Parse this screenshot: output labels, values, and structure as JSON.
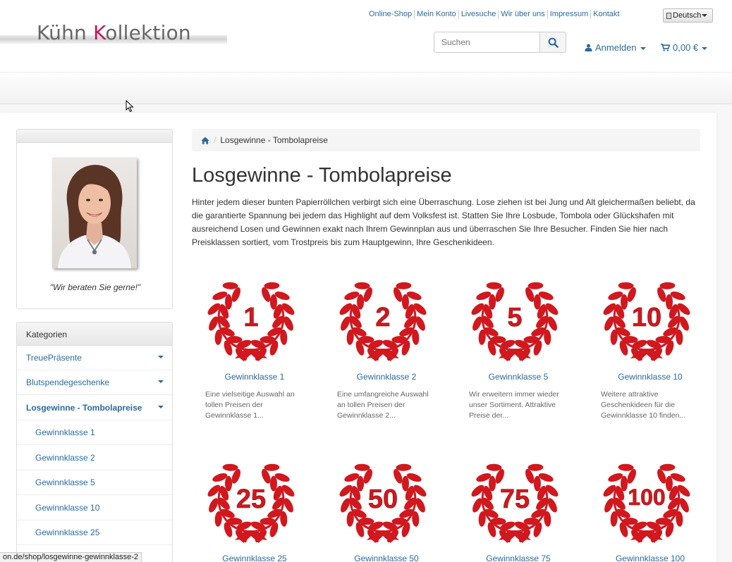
{
  "header": {
    "logo": {
      "part1": "Kühn ",
      "k": "K",
      "part2": "ollektion"
    },
    "top_links": [
      "Online-Shop",
      "Mein Konto",
      "Livesuche",
      "Wir über uns",
      "Impressum",
      "Kontakt"
    ],
    "language": "Deutsch",
    "search": {
      "placeholder": "Suchen"
    },
    "login_label": "Anmelden",
    "cart_label": "0,00 €"
  },
  "sidebar": {
    "quote": "\"Wir beraten Sie gerne!\"",
    "categories_title": "Kategorien",
    "categories": [
      {
        "label": "TreuePräsente",
        "dropdown": true
      },
      {
        "label": "Blutspendegeschenke",
        "dropdown": true
      },
      {
        "label": "Losgewinne - Tombolapreise",
        "dropdown": true,
        "active": true
      },
      {
        "label": "Gewinnklasse 1",
        "sub": true
      },
      {
        "label": "Gewinnklasse 2",
        "sub": true
      },
      {
        "label": "Gewinnklasse 5",
        "sub": true
      },
      {
        "label": "Gewinnklasse 10",
        "sub": true
      },
      {
        "label": "Gewinnklasse 25",
        "sub": true
      }
    ]
  },
  "main": {
    "breadcrumb_current": "Losgewinne - Tombolapreise",
    "title": "Losgewinne - Tombolapreise",
    "intro": "Hinter jedem dieser bunten Papierröllchen verbirgt sich eine Überraschung. Lose ziehen ist bei Jung und Alt gleichermaßen beliebt, da die garantierte Spannung bei jedem das Highlight auf dem Volksfest ist. Statten Sie Ihre Losbude, Tombola oder Glückshafen mit ausreichend Losen und Gewinnen exakt nach Ihrem Gewinnplan aus und überraschen Sie Ihre Besucher. Finden Sie hier nach Preisklassen sortiert, vom Trostpreis bis zum Hauptgewinn, Ihre Geschenkideen.",
    "products": [
      {
        "number": "1",
        "name": "Gewinnklasse 1",
        "desc": "Eine vielseitige Auswahl an tollen Preisen der Gewinnklasse 1..."
      },
      {
        "number": "2",
        "name": "Gewinnklasse 2",
        "desc": "Eine umfangreiche Auswahl an tollen Preisen der Gewinnklasse 2..."
      },
      {
        "number": "5",
        "name": "Gewinnklasse 5",
        "desc": "Wir erweitern immer wieder unser Sortiment. Attraktive Preise der..."
      },
      {
        "number": "10",
        "name": "Gewinnklasse 10",
        "desc": "Weitere attraktive Geschenkideen für die Gewinnklasse 10 finden..."
      },
      {
        "number": "25",
        "name": "Gewinnklasse 25",
        "desc": ""
      },
      {
        "number": "50",
        "name": "Gewinnklasse 50",
        "desc": ""
      },
      {
        "number": "75",
        "name": "Gewinnklasse 75",
        "desc": ""
      },
      {
        "number": "100",
        "name": "Gewinnklasse 100",
        "desc": ""
      }
    ]
  },
  "status_bar": "on.de/shop/losgewinne-gewinnklasse-2",
  "colors": {
    "link": "#2a6a9e",
    "wreath": "#d0181e",
    "logo_k": "#c2185b"
  }
}
